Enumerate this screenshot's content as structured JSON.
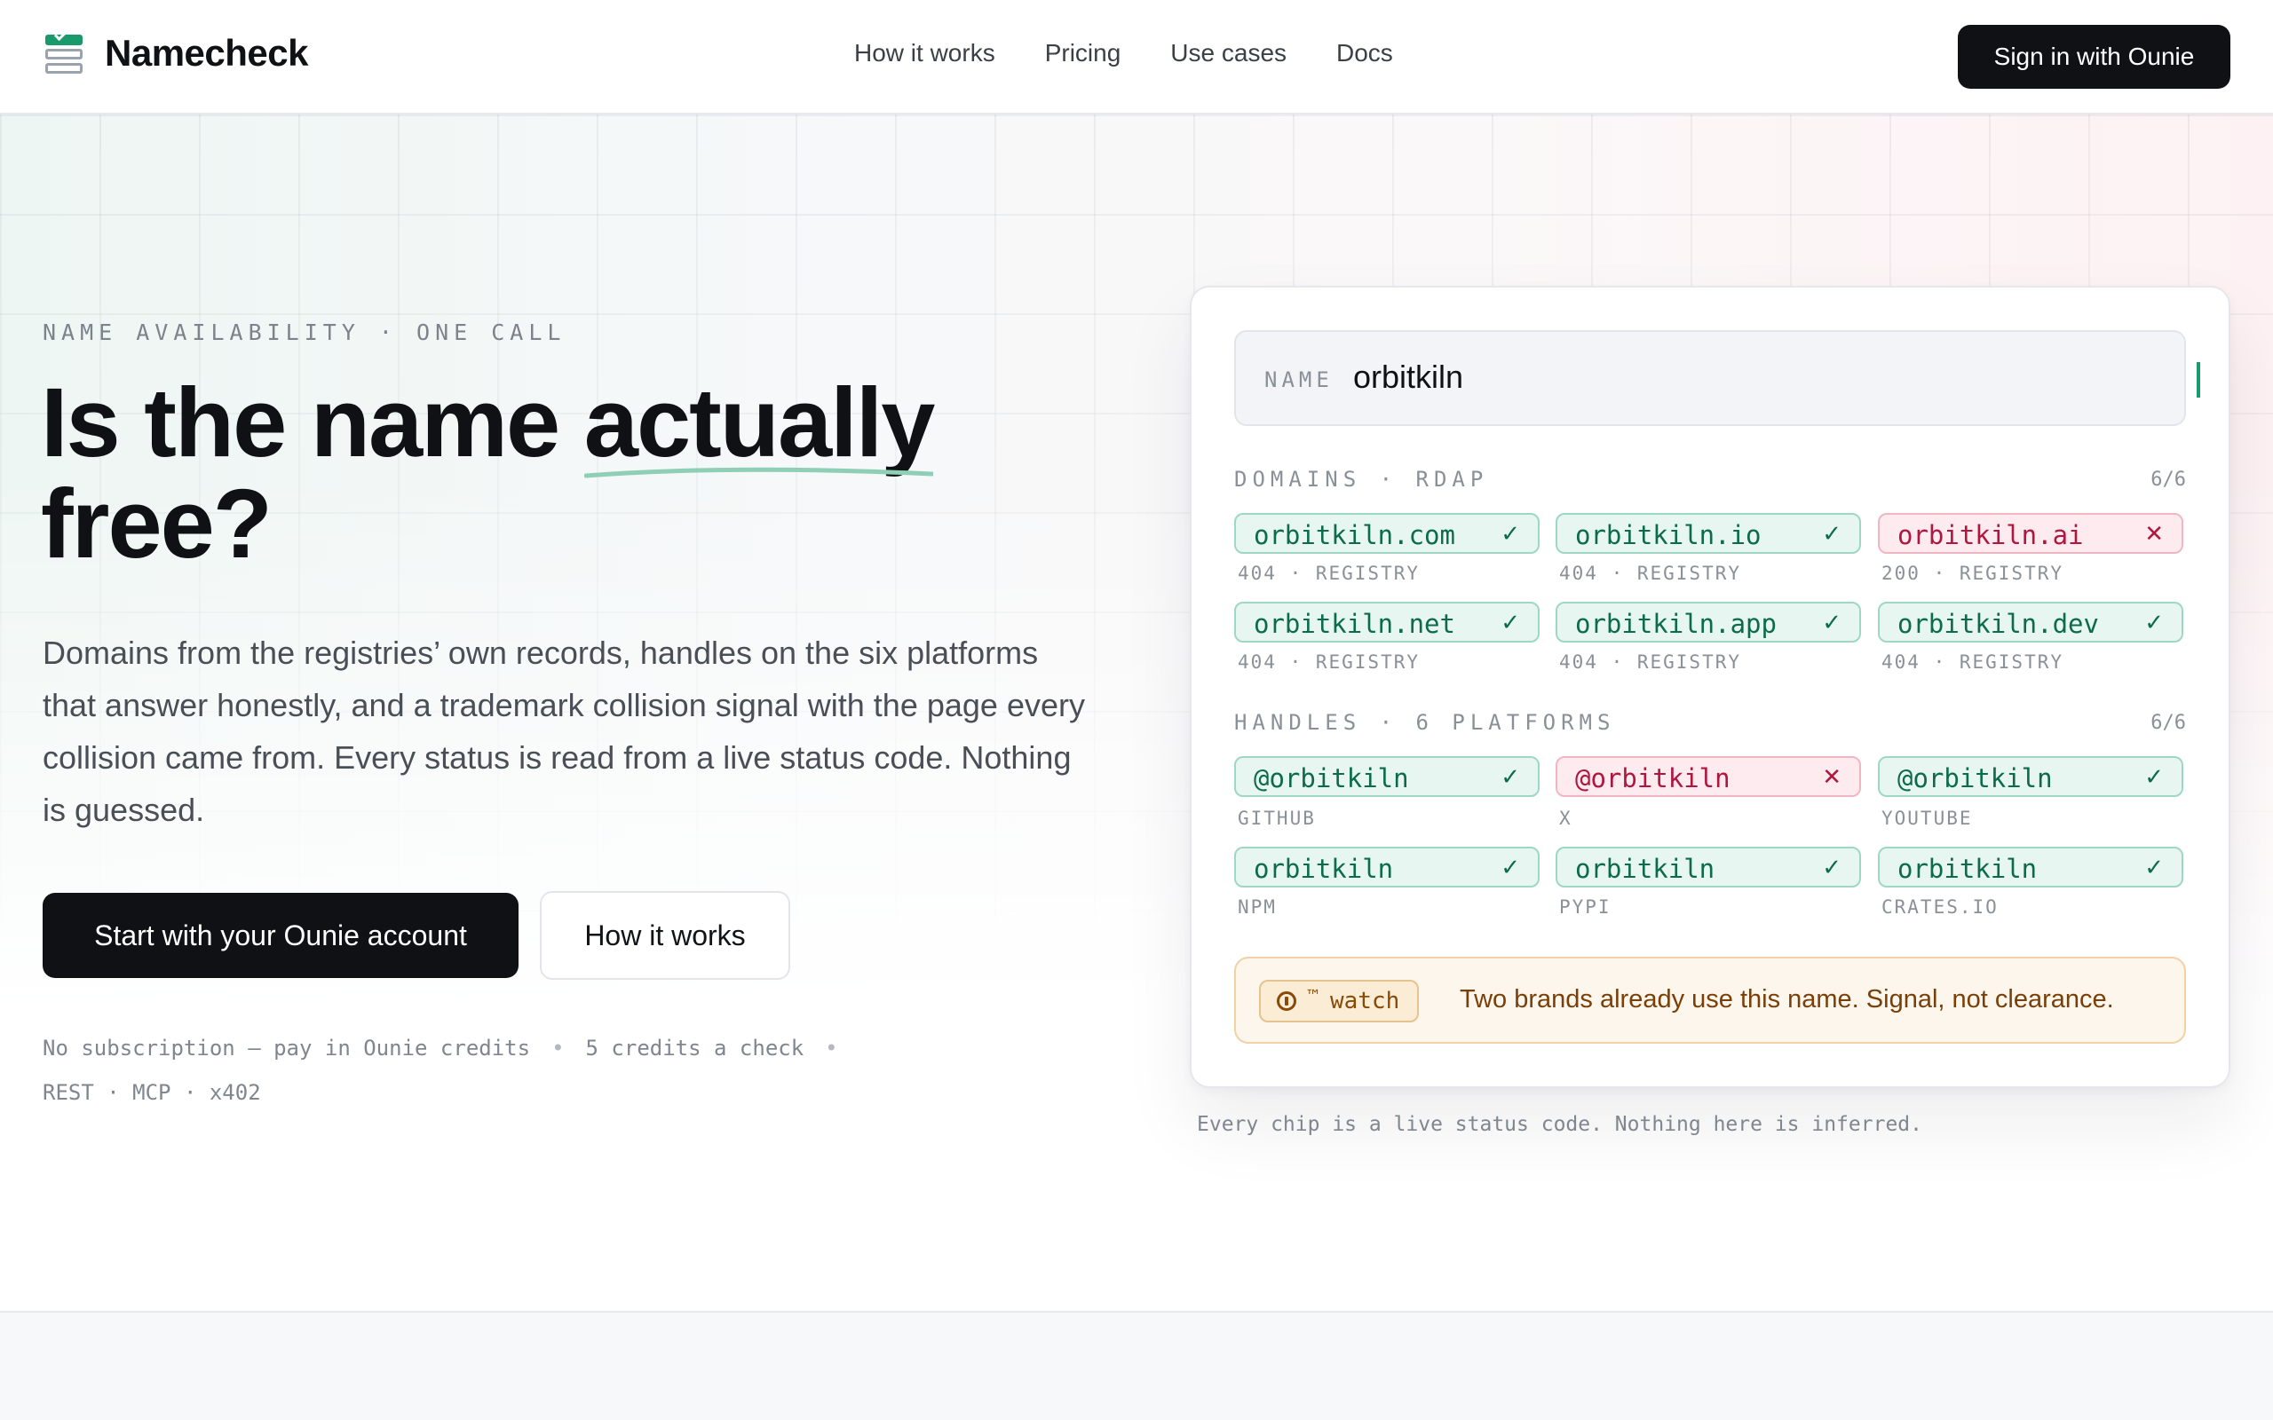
{
  "header": {
    "brand": "Namecheck",
    "nav": [
      "How it works",
      "Pricing",
      "Use cases",
      "Docs"
    ],
    "signin": "Sign in with Ounie"
  },
  "hero": {
    "eyebrow": "NAME AVAILABILITY · ONE CALL",
    "headline_pre": "Is the name ",
    "headline_highlight": "actually",
    "headline_post": "free?",
    "lead": "Domains from the registries’ own records, handles on the six platforms that answer honestly, and a trademark collision signal with the page every collision came from. Every status is read from a live status code. Nothing is guessed.",
    "cta_primary": "Start with your Ounie account",
    "cta_secondary": "How it works",
    "meta": [
      "No subscription — pay in Ounie credits",
      "5 credits a check",
      "REST · MCP · x402"
    ],
    "accent": "#1a9a6c"
  },
  "card": {
    "input_label": "NAME",
    "input_value": "orbitkiln",
    "domains_label": "DOMAINS · RDAP",
    "domains_count": "6/6",
    "domains": [
      {
        "name": "orbitkiln.com",
        "status": "404 · REGISTRY",
        "available": true
      },
      {
        "name": "orbitkiln.io",
        "status": "404 · REGISTRY",
        "available": true
      },
      {
        "name": "orbitkiln.ai",
        "status": "200 · REGISTRY",
        "available": false
      },
      {
        "name": "orbitkiln.net",
        "status": "404 · REGISTRY",
        "available": true
      },
      {
        "name": "orbitkiln.app",
        "status": "404 · REGISTRY",
        "available": true
      },
      {
        "name": "orbitkiln.dev",
        "status": "404 · REGISTRY",
        "available": true
      }
    ],
    "handles_label": "HANDLES · 6 PLATFORMS",
    "handles_count": "6/6",
    "handles": [
      {
        "name": "@orbitkiln",
        "platform": "GITHUB",
        "available": true
      },
      {
        "name": "@orbitkiln",
        "platform": "X",
        "available": false
      },
      {
        "name": "@orbitkiln",
        "platform": "YOUTUBE",
        "available": true
      },
      {
        "name": "orbitkiln",
        "platform": "NPM",
        "available": true
      },
      {
        "name": "orbitkiln",
        "platform": "PYPI",
        "available": true
      },
      {
        "name": "orbitkiln",
        "platform": "CRATES.IO",
        "available": true
      }
    ],
    "trademark_badge_mark": "™",
    "trademark_badge": "watch",
    "trademark_message": "Two brands already use this name. Signal, not clearance.",
    "available_mark": "✓",
    "taken_mark": "✕",
    "available_color": "#0c6b4a",
    "taken_color": "#b0163e"
  },
  "caption": "Every chip is a live status code. Nothing here is inferred."
}
